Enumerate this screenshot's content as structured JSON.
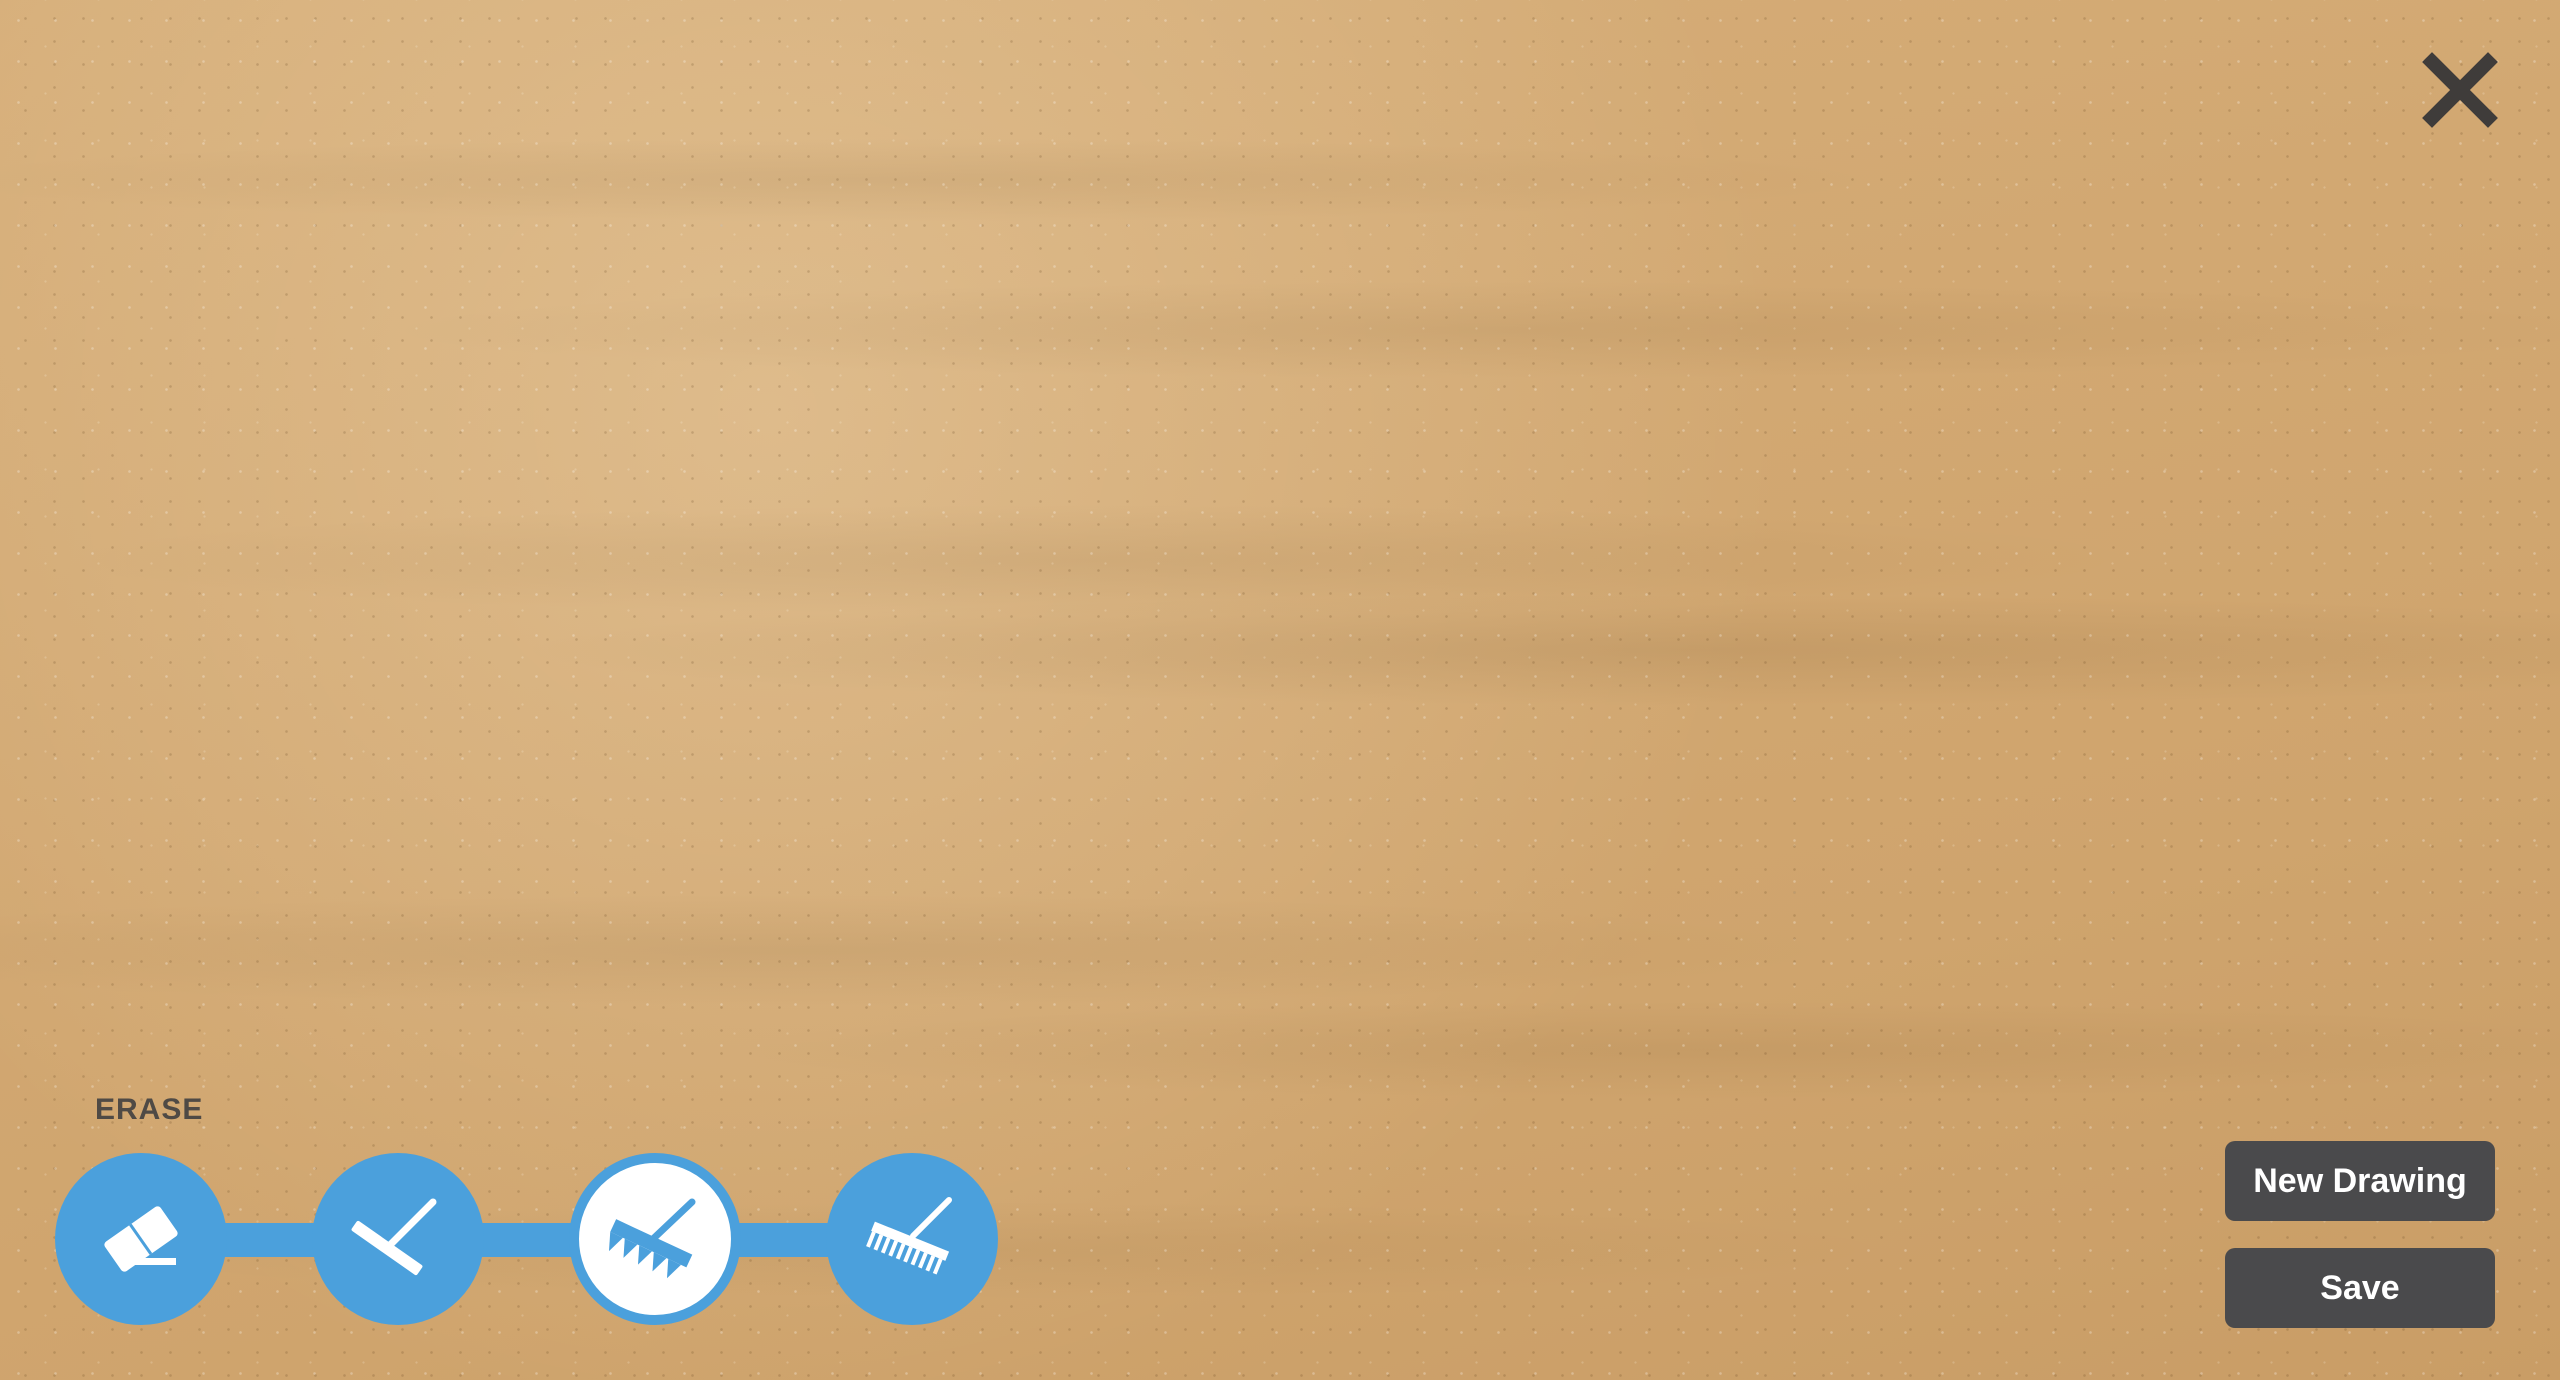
{
  "canvas": {
    "texture": "sand"
  },
  "colors": {
    "accent": "#4ba0dc",
    "button_bg": "#4a4a4c",
    "label_text": "#4f4a45",
    "close_icon": "#3f3c3a"
  },
  "close": {
    "icon": "close-icon"
  },
  "tools": {
    "active_label": "ERASE",
    "selected_index": 2,
    "items": [
      {
        "icon": "eraser-icon"
      },
      {
        "icon": "flat-rake-icon"
      },
      {
        "icon": "wide-tooth-rake-icon"
      },
      {
        "icon": "fine-tooth-rake-icon"
      }
    ]
  },
  "actions": {
    "new_drawing_label": "New Drawing",
    "save_label": "Save"
  }
}
